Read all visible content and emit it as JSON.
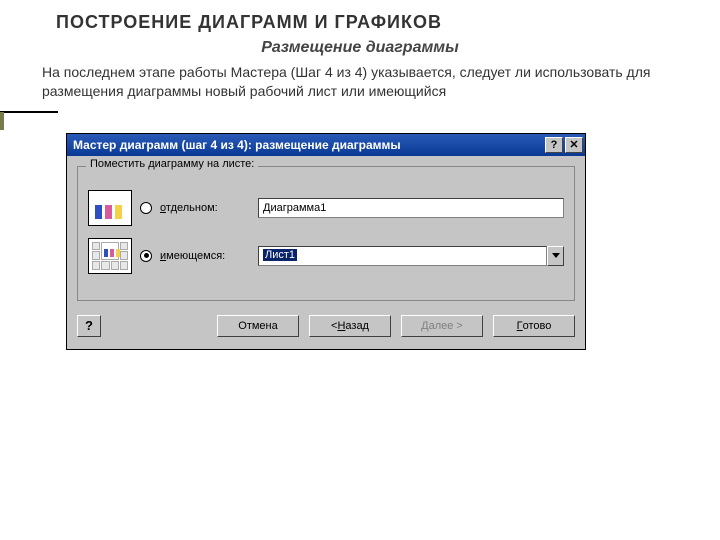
{
  "slide": {
    "heading": "ПОСТРОЕНИЕ  ДИАГРАММ И  ГРАФИКОВ",
    "subheading": "Размещение диаграммы",
    "body": "На последнем этапе работы Мастера (Шаг 4 из 4) указывается, следует ли использовать для размещения диаграммы новый рабочий лист или  имеющийся"
  },
  "dialog": {
    "title": "Мастер диаграмм (шаг 4 из 4): размещение диаграммы",
    "group_label": "Поместить диаграмму на листе:",
    "radio1": {
      "prefix": "о",
      "rest": "тдельном:"
    },
    "radio2": {
      "prefix": "и",
      "rest": "меющемся:"
    },
    "input_separate": "Диаграмма1",
    "combo_existing": "Лист1",
    "help": "?",
    "btn_cancel": "Отмена",
    "btn_back": {
      "lt": "< ",
      "u": "Н",
      "rest": "азад"
    },
    "btn_next": {
      "u": "Д",
      "rest": "алее >"
    },
    "btn_finish": {
      "u": "Г",
      "rest": "отово"
    },
    "close_x": "✕",
    "close_q": "?"
  }
}
